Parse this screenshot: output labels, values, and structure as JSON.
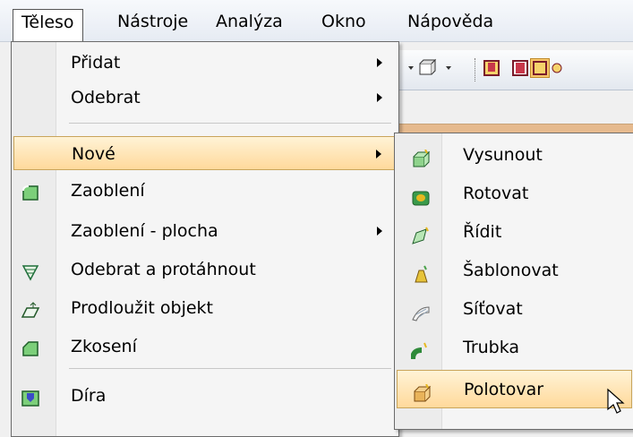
{
  "menubar": {
    "items": [
      "Těleso",
      "Nástroje",
      "Analýza",
      "Okno",
      "Nápověda"
    ]
  },
  "menu": {
    "items": [
      {
        "label": "Přidat",
        "icon": "",
        "submenu": true
      },
      {
        "label": "Odebrat",
        "icon": "",
        "submenu": true
      },
      {
        "label": "Nové",
        "icon": "",
        "submenu": true,
        "highlighted": true
      },
      {
        "label": "Zaoblení",
        "icon": "fillet-icon"
      },
      {
        "label": "Zaoblení - plocha",
        "icon": "",
        "submenu": true
      },
      {
        "label": "Odebrat a protáhnout",
        "icon": "remove-sweep-icon"
      },
      {
        "label": "Prodloužit objekt",
        "icon": "extend-object-icon"
      },
      {
        "label": "Zkosení",
        "icon": "chamfer-icon"
      },
      {
        "label": "Díra",
        "icon": "hole-icon"
      }
    ]
  },
  "submenu": {
    "items": [
      {
        "label": "Vysunout",
        "icon": "extrude-icon"
      },
      {
        "label": "Rotovat",
        "icon": "revolve-icon"
      },
      {
        "label": "Řídit",
        "icon": "sweep-icon"
      },
      {
        "label": "Šablonovat",
        "icon": "loft-icon"
      },
      {
        "label": "Síťovat",
        "icon": "mesh-icon"
      },
      {
        "label": "Trubka",
        "icon": "pipe-icon"
      },
      {
        "label": "Polotovar",
        "icon": "stock-icon",
        "highlighted": true
      }
    ]
  },
  "colors": {
    "highlight": "#ffd99b",
    "highlight_border": "#c9a55b"
  }
}
